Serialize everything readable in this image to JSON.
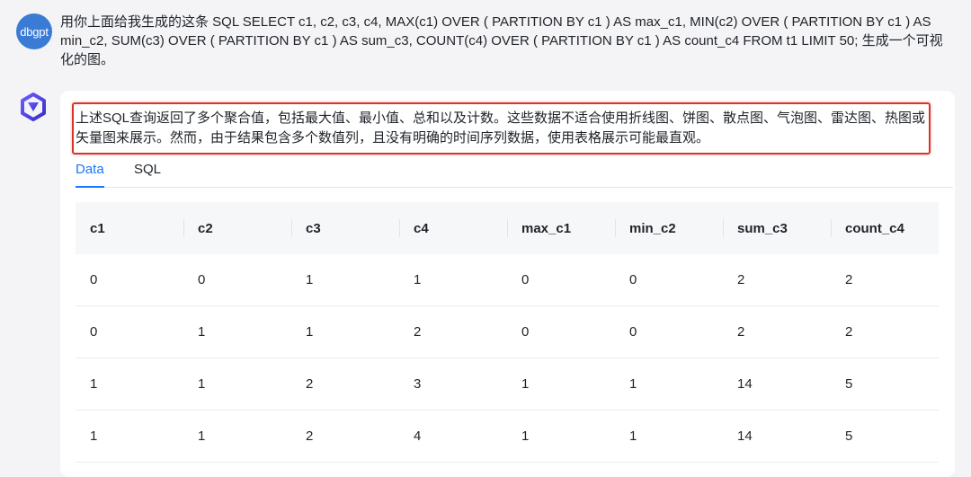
{
  "user_message": {
    "avatar_label": "dbgpt",
    "text": "用你上面给我生成的这条 SQL SELECT c1, c2, c3, c4, MAX(c1) OVER ( PARTITION BY c1 ) AS max_c1, MIN(c2) OVER ( PARTITION BY c1 ) AS min_c2, SUM(c3) OVER ( PARTITION BY c1 ) AS sum_c3, COUNT(c4) OVER ( PARTITION BY c1 ) AS count_c4 FROM t1 LIMIT 50; 生成一个可视化的图。"
  },
  "bot_message": {
    "icon": "assistant-logo-icon",
    "summary": "上述SQL查询返回了多个聚合值，包括最大值、最小值、总和以及计数。这些数据不适合使用折线图、饼图、散点图、气泡图、雷达图、热图或矢量图来展示。然而，由于结果包含多个数值列，且没有明确的时间序列数据，使用表格展示可能最直观。",
    "tabs": [
      {
        "label": "Data",
        "active": true
      },
      {
        "label": "SQL",
        "active": false
      }
    ],
    "table": {
      "columns": [
        "c1",
        "c2",
        "c3",
        "c4",
        "max_c1",
        "min_c2",
        "sum_c3",
        "count_c4"
      ],
      "rows": [
        [
          "0",
          "0",
          "1",
          "1",
          "0",
          "0",
          "2",
          "2"
        ],
        [
          "0",
          "1",
          "1",
          "2",
          "0",
          "0",
          "2",
          "2"
        ],
        [
          "1",
          "1",
          "2",
          "3",
          "1",
          "1",
          "14",
          "5"
        ],
        [
          "1",
          "1",
          "2",
          "4",
          "1",
          "1",
          "14",
          "5"
        ]
      ]
    }
  },
  "colors": {
    "accent": "#1677ff",
    "highlight_border": "#d9342b",
    "avatar_bg": "#3a7bd5"
  }
}
